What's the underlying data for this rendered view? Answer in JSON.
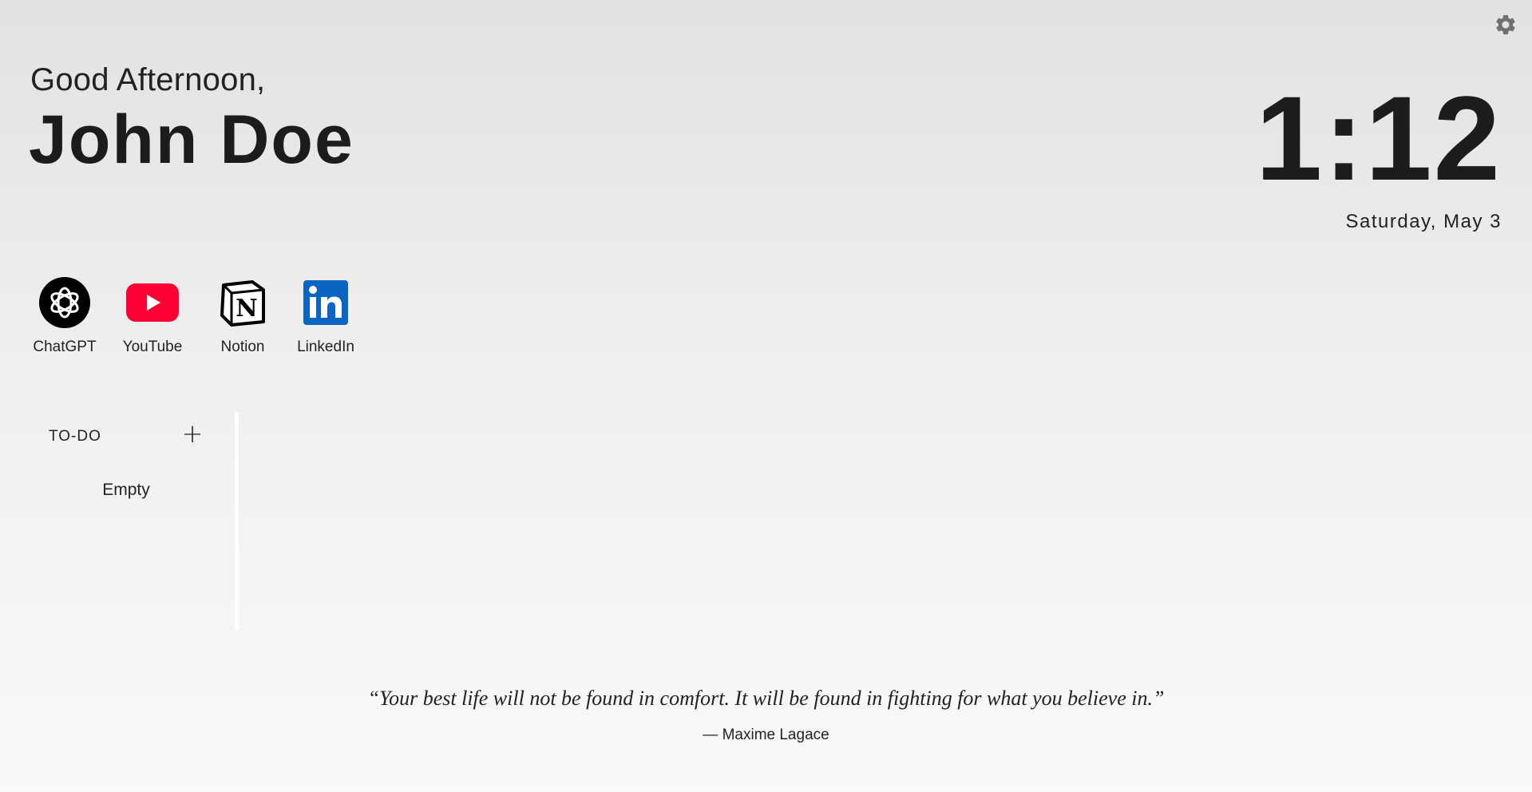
{
  "header": {
    "greeting": "Good Afternoon,",
    "username": "John Doe"
  },
  "clock": {
    "time": "1:12",
    "date": "Saturday, May 3"
  },
  "settings": {
    "icon": "gear-icon",
    "color": "#707070"
  },
  "shortcuts": [
    {
      "label": "ChatGPT",
      "icon": "chatgpt-icon",
      "color": "#000000"
    },
    {
      "label": "YouTube",
      "icon": "youtube-icon",
      "color": "#ff0033"
    },
    {
      "label": "Notion",
      "icon": "notion-icon",
      "color": "#000000"
    },
    {
      "label": "LinkedIn",
      "icon": "linkedin-icon",
      "color": "#0a66c2"
    }
  ],
  "todo": {
    "title": "TO-DO",
    "add_icon": "plus-icon",
    "empty_text": "Empty"
  },
  "quote": {
    "text": "“Your best life will not be found in comfort. It will be found in fighting for what you believe in.”",
    "author": "— Maxime Lagace"
  }
}
